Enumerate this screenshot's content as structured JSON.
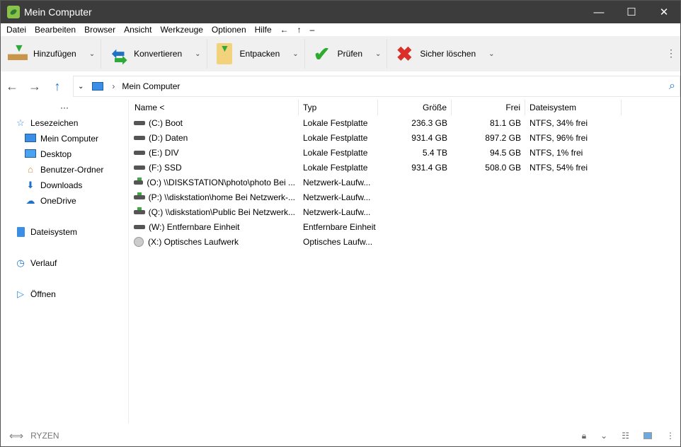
{
  "window": {
    "title": "Mein Computer",
    "minimize": "—",
    "maximize": "☐",
    "close": "✕"
  },
  "menu": [
    "Datei",
    "Bearbeiten",
    "Browser",
    "Ansicht",
    "Werkzeuge",
    "Optionen",
    "Hilfe",
    "←",
    "↑",
    "–"
  ],
  "toolbar": [
    {
      "label": "Hinzufügen",
      "icon": "box-add-icon"
    },
    {
      "label": "Konvertieren",
      "icon": "convert-icon"
    },
    {
      "label": "Entpacken",
      "icon": "extract-icon"
    },
    {
      "label": "Prüfen",
      "icon": "check-icon"
    },
    {
      "label": "Sicher löschen",
      "icon": "delete-icon"
    }
  ],
  "address": {
    "path": "Mein Computer"
  },
  "sidebar": {
    "collapse": "···",
    "bookmarks": "Lesezeichen",
    "items": [
      "Mein Computer",
      "Desktop",
      "Benutzer-Ordner",
      "Downloads",
      "OneDrive"
    ],
    "filesystem": "Dateisystem",
    "history": "Verlauf",
    "open": "Öffnen"
  },
  "columns": [
    "Name <",
    "Typ",
    "Größe",
    "Frei",
    "Dateisystem"
  ],
  "rows": [
    {
      "name": "(C:) Boot",
      "type": "Lokale Festplatte",
      "size": "236.3 GB",
      "free": "81.1 GB",
      "fs": "NTFS, 34% frei",
      "kind": "hdd"
    },
    {
      "name": "(D:) Daten",
      "type": "Lokale Festplatte",
      "size": "931.4 GB",
      "free": "897.2 GB",
      "fs": "NTFS, 96% frei",
      "kind": "hdd"
    },
    {
      "name": "(E:) DIV",
      "type": "Lokale Festplatte",
      "size": "5.4 TB",
      "free": "94.5 GB",
      "fs": "NTFS, 1% frei",
      "kind": "hdd"
    },
    {
      "name": "(F:) SSD",
      "type": "Lokale Festplatte",
      "size": "931.4 GB",
      "free": "508.0 GB",
      "fs": "NTFS, 54% frei",
      "kind": "hdd"
    },
    {
      "name": "(O:) \\\\DISKSTATION\\photo\\photo Bei ...",
      "type": "Netzwerk-Laufw...",
      "size": "",
      "free": "",
      "fs": "",
      "kind": "net"
    },
    {
      "name": "(P:) \\\\diskstation\\home Bei Netzwerk-...",
      "type": "Netzwerk-Laufw...",
      "size": "",
      "free": "",
      "fs": "",
      "kind": "net"
    },
    {
      "name": "(Q:) \\\\diskstation\\Public Bei Netzwerk...",
      "type": "Netzwerk-Laufw...",
      "size": "",
      "free": "",
      "fs": "",
      "kind": "net"
    },
    {
      "name": "(W:) Entfernbare Einheit",
      "type": "Entfernbare Einheit",
      "size": "",
      "free": "",
      "fs": "",
      "kind": "hdd"
    },
    {
      "name": "(X:) Optisches Laufwerk",
      "type": "Optisches Laufw...",
      "size": "",
      "free": "",
      "fs": "",
      "kind": "cd"
    }
  ],
  "status": {
    "computer": "RYZEN"
  }
}
